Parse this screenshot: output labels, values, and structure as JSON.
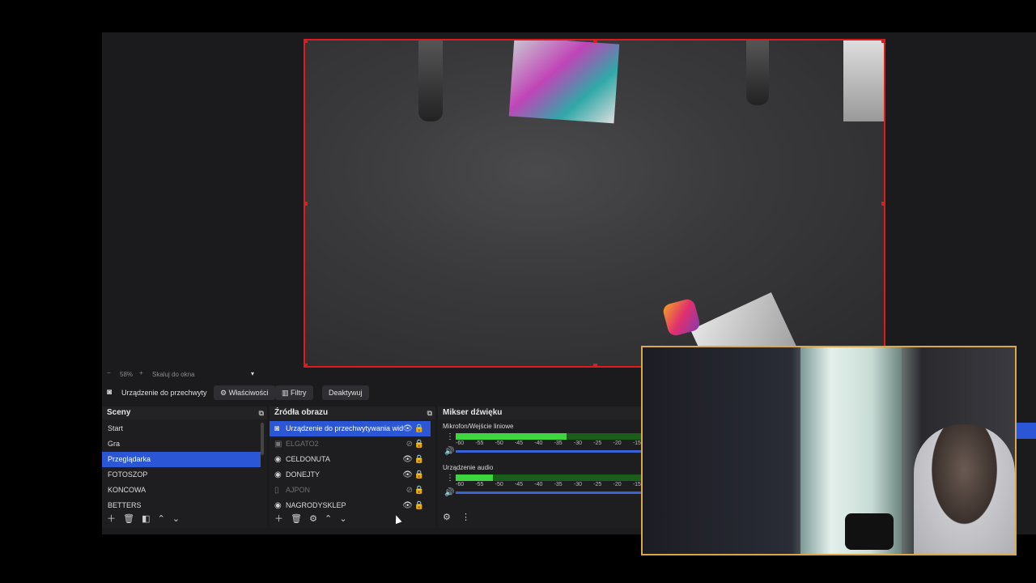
{
  "preview": {
    "zoom": "58%",
    "scale_mode": "Skaluj do okna"
  },
  "source_toolbar": {
    "source_name": "Urządzenie do przechwyty",
    "properties_label": "Właściwości",
    "filters_label": "Filtry",
    "deactivate_label": "Deaktywuj"
  },
  "scenes": {
    "title": "Sceny",
    "items": [
      "Start",
      "Gra",
      "Przeglądarka",
      "FOTOSZOP",
      "KONCOWA",
      "BETTERS"
    ],
    "selected": "Przeglądarka"
  },
  "sources": {
    "title": "Źródła obrazu",
    "items": [
      {
        "label": "Urządzenie do przechwytywania wid"
      },
      {
        "label": "ELGATO2"
      },
      {
        "label": "CELDONUTA"
      },
      {
        "label": "DONEJTY"
      },
      {
        "label": "AJPON"
      },
      {
        "label": "NAGRODYSKLEP"
      }
    ]
  },
  "mixer": {
    "title": "Mikser dźwięku",
    "channels": [
      {
        "name": "Mikrofon/Wejście liniowe",
        "level": 0.6
      },
      {
        "name": "Urządzenie audio",
        "level": 0.2
      }
    ],
    "ticks": [
      "-60",
      "-55",
      "-50",
      "-45",
      "-40",
      "-35",
      "-30",
      "-25",
      "-20",
      "-15"
    ]
  }
}
